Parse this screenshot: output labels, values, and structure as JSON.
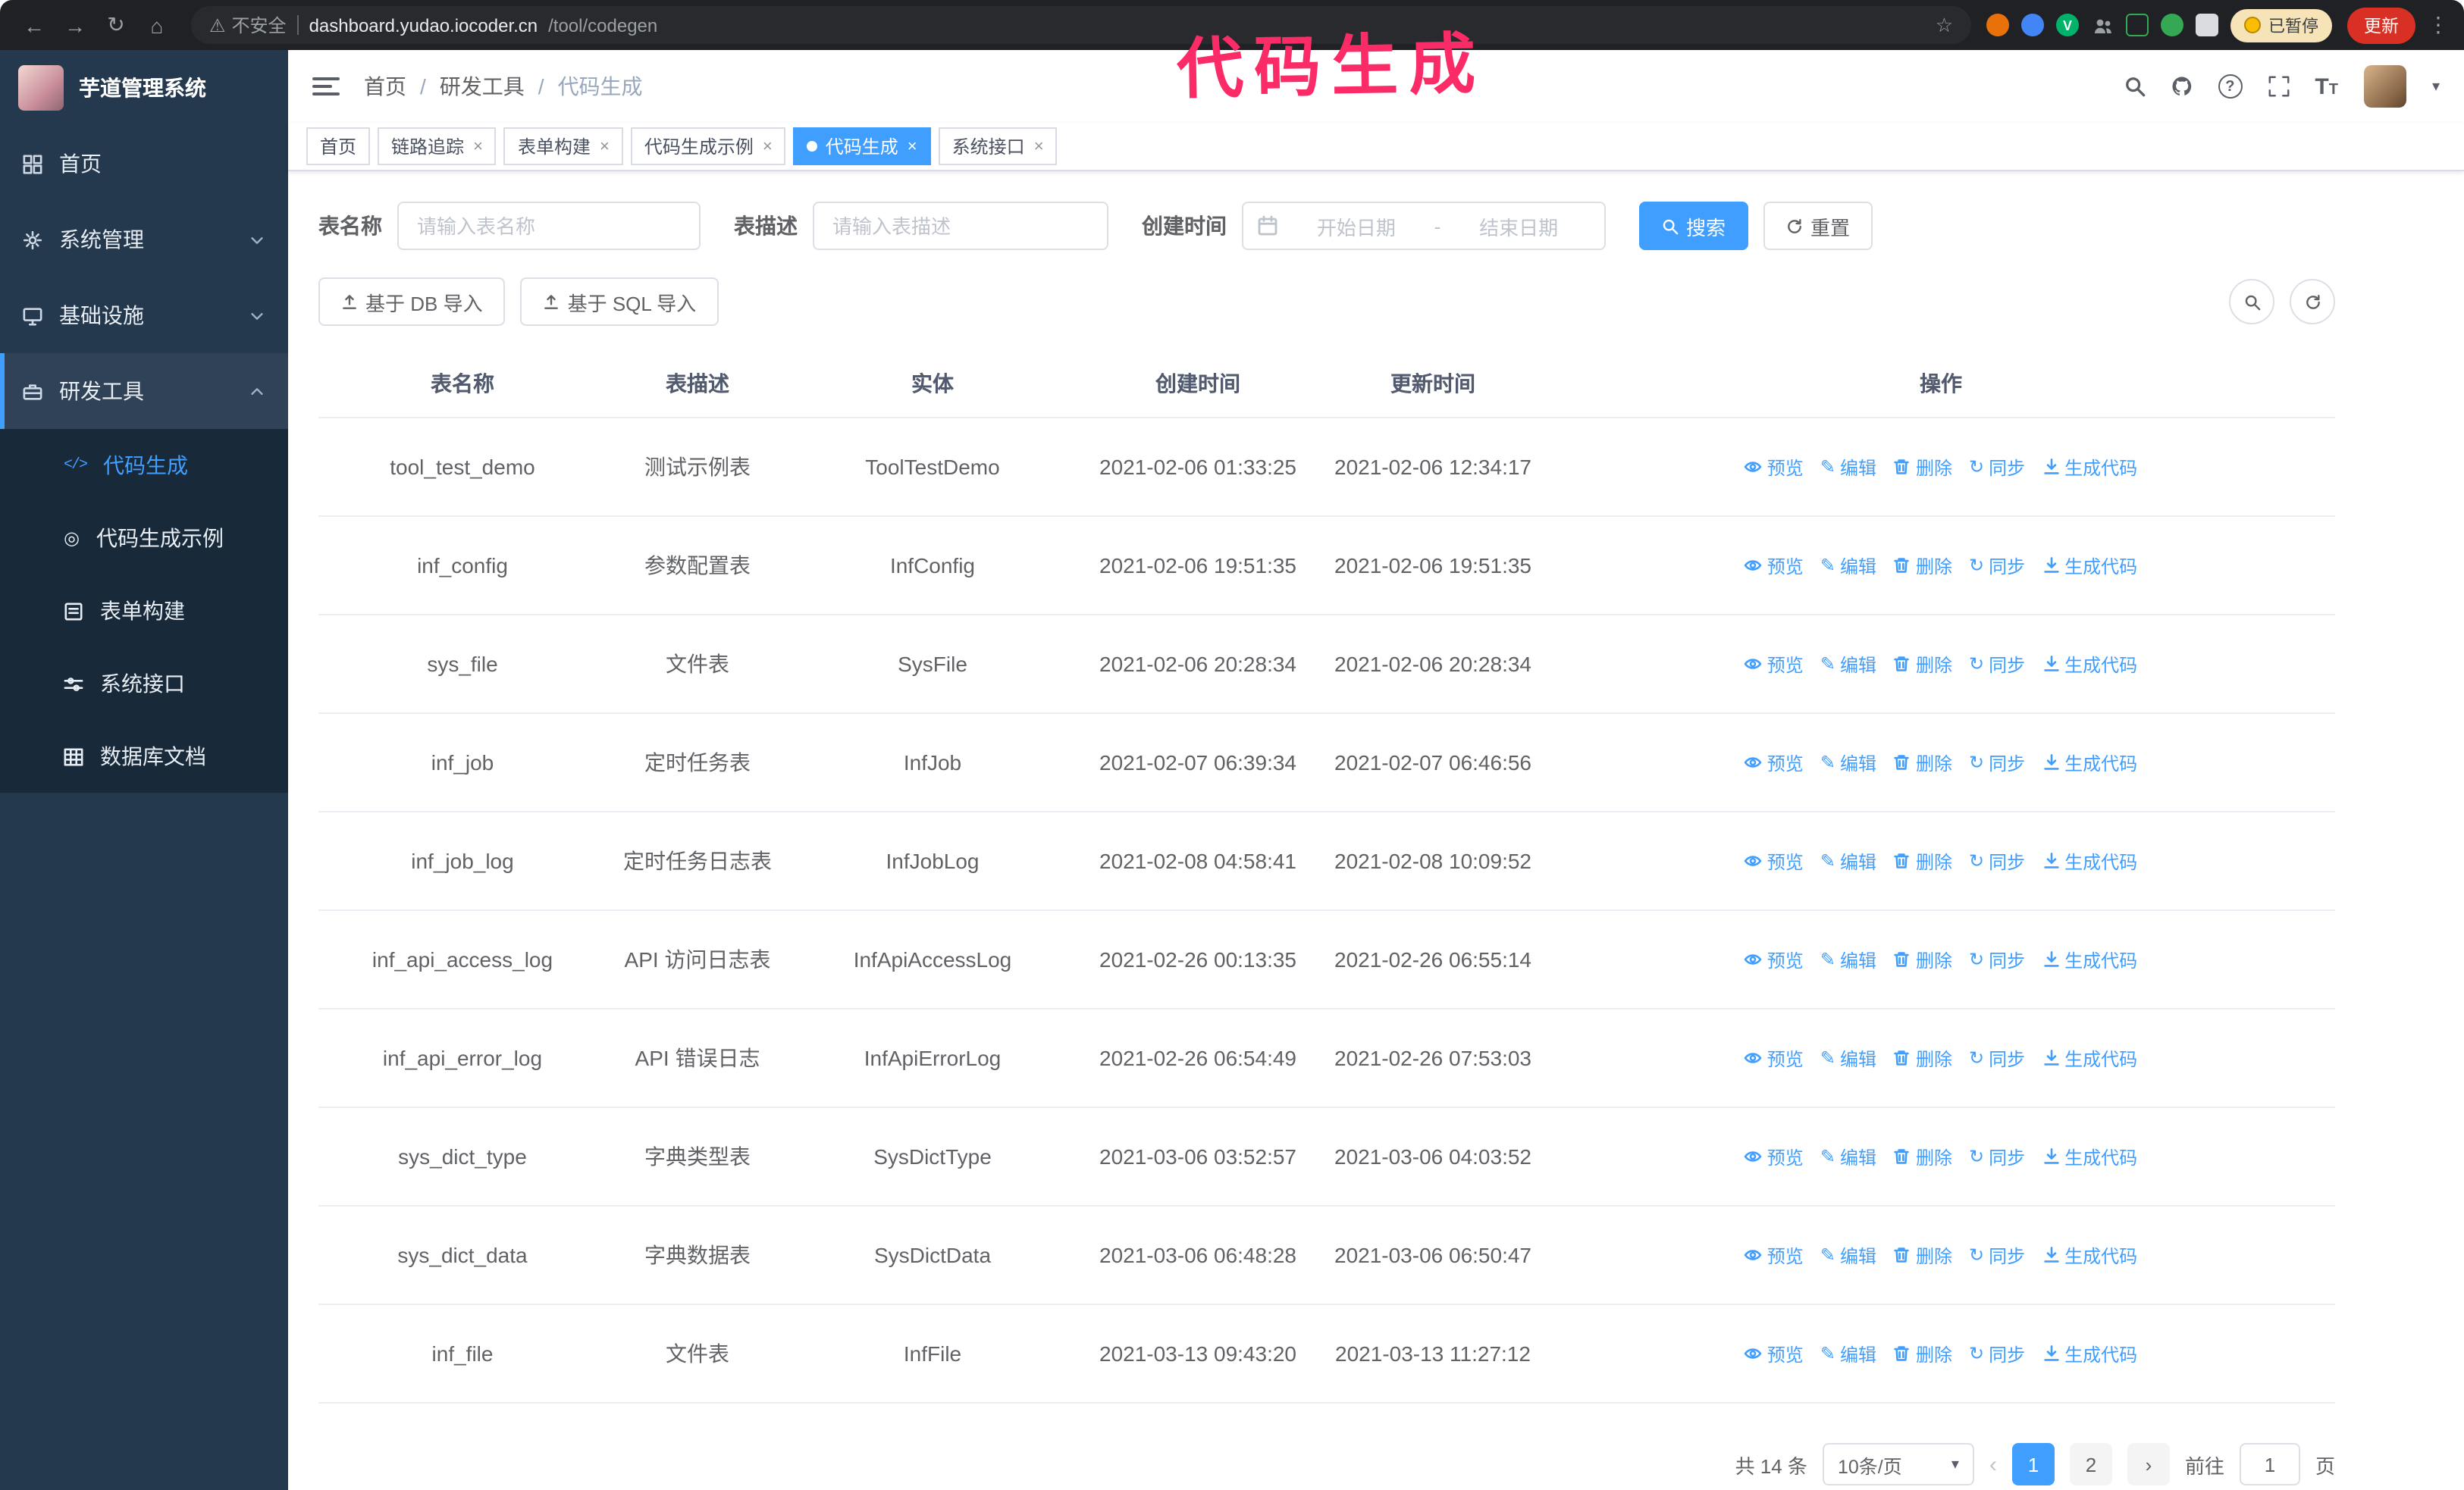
{
  "annotation": {
    "text": "代码生成"
  },
  "chrome": {
    "security": "不安全",
    "url_host": "dashboard.yudao.iocoder.cn",
    "url_path": "/tool/codegen",
    "paused": "已暂停",
    "update": "更新",
    "v_badge": "V"
  },
  "glyphs": {
    "back": "←",
    "forward": "→",
    "reload": "↻",
    "home": "⌂",
    "star": "☆",
    "kebab": "⋮",
    "caret": "▾",
    "close": "×",
    "pencil": "✎",
    "sync": "↻",
    "code": "</>",
    "target": "◎",
    "prev": "‹",
    "next": "›",
    "warning": "⚠"
  },
  "sidebar": {
    "title": "芋道管理系统",
    "items": [
      {
        "label": "首页"
      },
      {
        "label": "系统管理"
      },
      {
        "label": "基础设施"
      },
      {
        "label": "研发工具"
      }
    ],
    "subitems": [
      {
        "label": "代码生成"
      },
      {
        "label": "代码生成示例"
      },
      {
        "label": "表单构建"
      },
      {
        "label": "系统接口"
      },
      {
        "label": "数据库文档"
      }
    ]
  },
  "header": {
    "breadcrumb": [
      "首页",
      "研发工具",
      "代码生成"
    ],
    "sep": "/"
  },
  "tabs": [
    {
      "label": "首页"
    },
    {
      "label": "链路追踪"
    },
    {
      "label": "表单构建"
    },
    {
      "label": "代码生成示例"
    },
    {
      "label": "代码生成"
    },
    {
      "label": "系统接口"
    }
  ],
  "filters": {
    "name_label": "表名称",
    "name_placeholder": "请输入表名称",
    "desc_label": "表描述",
    "desc_placeholder": "请输入表描述",
    "time_label": "创建时间",
    "start_placeholder": "开始日期",
    "end_placeholder": "结束日期",
    "range_sep": "-",
    "search": "搜索",
    "reset": "重置"
  },
  "toolbar": {
    "import_db": "基于 DB 导入",
    "import_sql": "基于 SQL 导入"
  },
  "table": {
    "columns": [
      "表名称",
      "表描述",
      "实体",
      "创建时间",
      "更新时间",
      "操作"
    ],
    "actions": [
      "预览",
      "编辑",
      "删除",
      "同步",
      "生成代码"
    ],
    "rows": [
      {
        "name": "tool_test_demo",
        "desc": "测试示例表",
        "entity": "ToolTestDemo",
        "created": "2021-02-06 01:33:25",
        "updated": "2021-02-06 12:34:17"
      },
      {
        "name": "inf_config",
        "desc": "参数配置表",
        "entity": "InfConfig",
        "created": "2021-02-06 19:51:35",
        "updated": "2021-02-06 19:51:35"
      },
      {
        "name": "sys_file",
        "desc": "文件表",
        "entity": "SysFile",
        "created": "2021-02-06 20:28:34",
        "updated": "2021-02-06 20:28:34"
      },
      {
        "name": "inf_job",
        "desc": "定时任务表",
        "entity": "InfJob",
        "created": "2021-02-07 06:39:34",
        "updated": "2021-02-07 06:46:56"
      },
      {
        "name": "inf_job_log",
        "desc": "定时任务日志表",
        "entity": "InfJobLog",
        "created": "2021-02-08 04:58:41",
        "updated": "2021-02-08 10:09:52"
      },
      {
        "name": "inf_api_access_log",
        "desc": "API 访问日志表",
        "entity": "InfApiAccessLog",
        "created": "2021-02-26 00:13:35",
        "updated": "2021-02-26 06:55:14"
      },
      {
        "name": "inf_api_error_log",
        "desc": "API 错误日志",
        "entity": "InfApiErrorLog",
        "created": "2021-02-26 06:54:49",
        "updated": "2021-02-26 07:53:03"
      },
      {
        "name": "sys_dict_type",
        "desc": "字典类型表",
        "entity": "SysDictType",
        "created": "2021-03-06 03:52:57",
        "updated": "2021-03-06 04:03:52"
      },
      {
        "name": "sys_dict_data",
        "desc": "字典数据表",
        "entity": "SysDictData",
        "created": "2021-03-06 06:48:28",
        "updated": "2021-03-06 06:50:47"
      },
      {
        "name": "inf_file",
        "desc": "文件表",
        "entity": "InfFile",
        "created": "2021-03-13 09:43:20",
        "updated": "2021-03-13 11:27:12"
      }
    ]
  },
  "pagination": {
    "total": "共 14 条",
    "size": "10条/页",
    "page1": "1",
    "page2": "2",
    "goto": "前往",
    "goto_value": "1",
    "page_unit": "页"
  }
}
